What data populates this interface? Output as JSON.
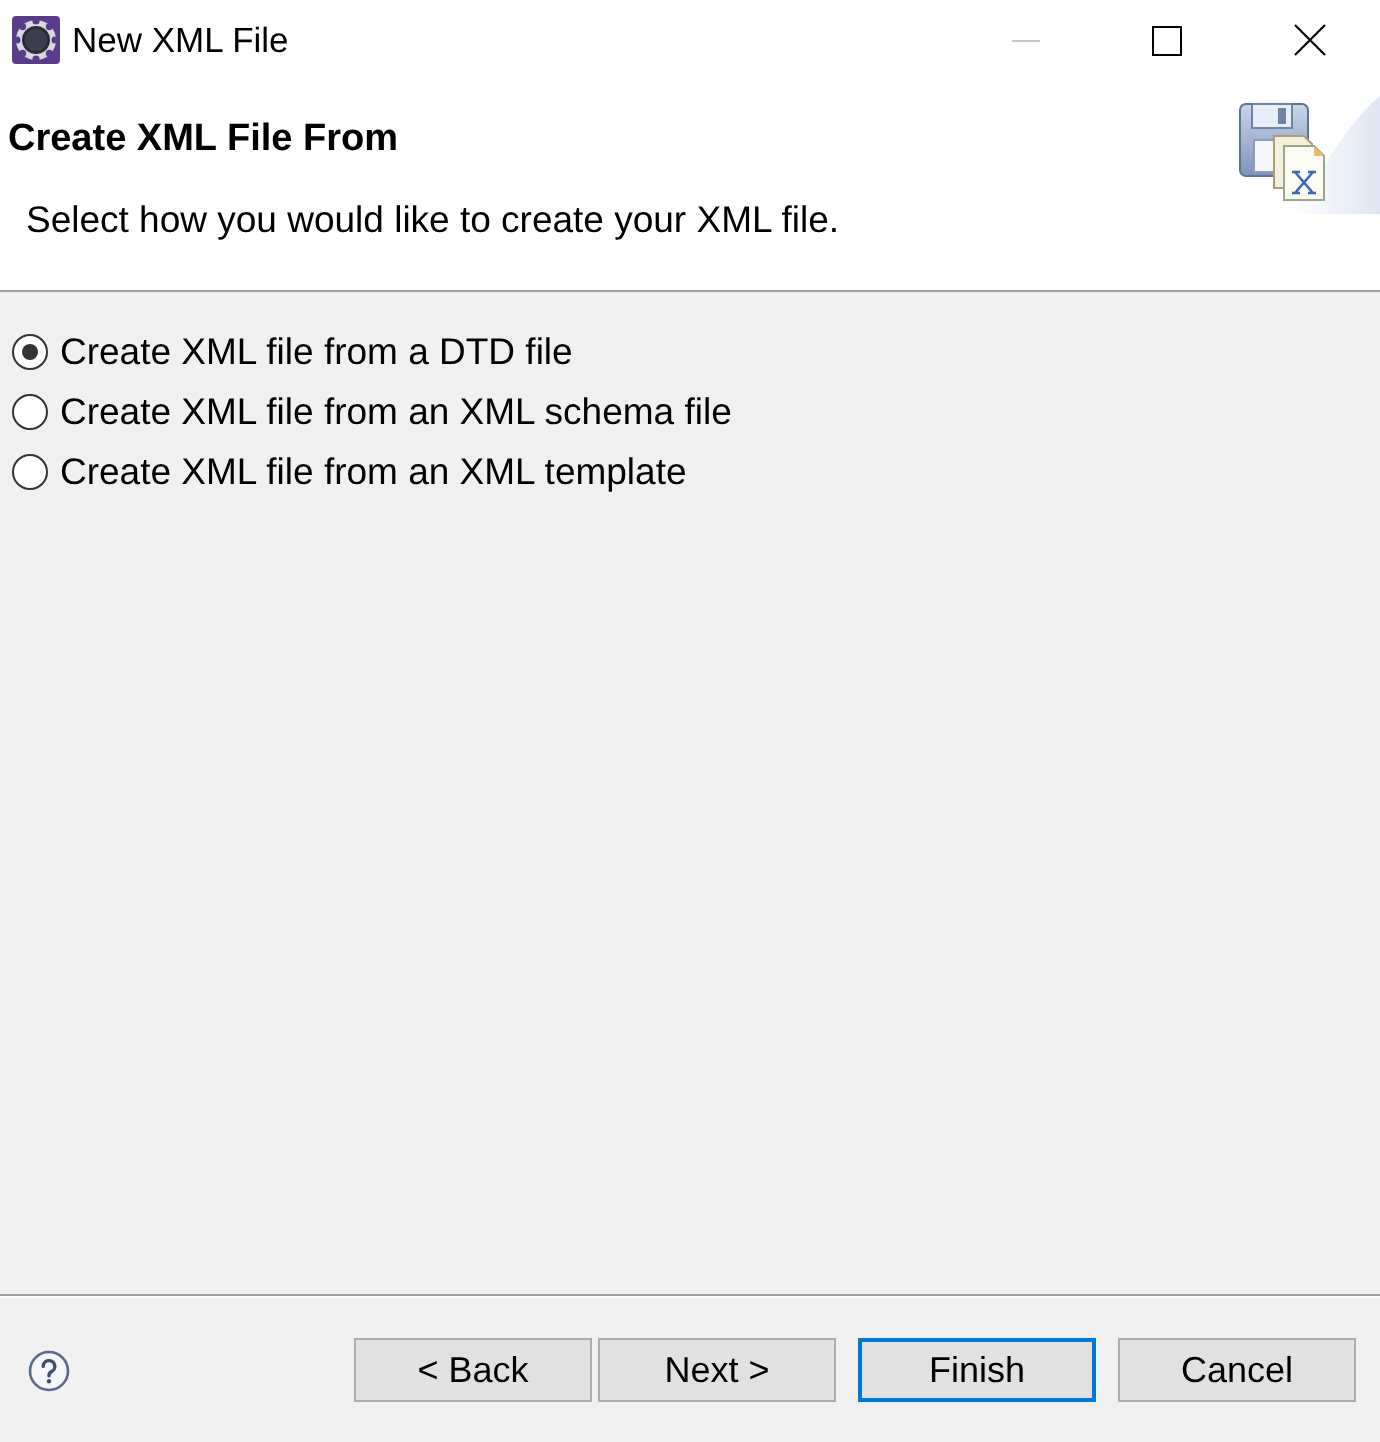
{
  "window": {
    "title": "New XML File"
  },
  "header": {
    "title": "Create XML File From",
    "description": "Select how you would like to create your XML file."
  },
  "options": [
    {
      "label": "Create XML file from a DTD file",
      "selected": true
    },
    {
      "label": "Create XML file from an XML schema file",
      "selected": false
    },
    {
      "label": "Create XML file from an XML template",
      "selected": false
    }
  ],
  "buttons": [
    {
      "label": "< Back",
      "default": false
    },
    {
      "label": "Next >",
      "default": false
    },
    {
      "label": "Finish",
      "default": true
    },
    {
      "label": "Cancel",
      "default": false
    }
  ]
}
